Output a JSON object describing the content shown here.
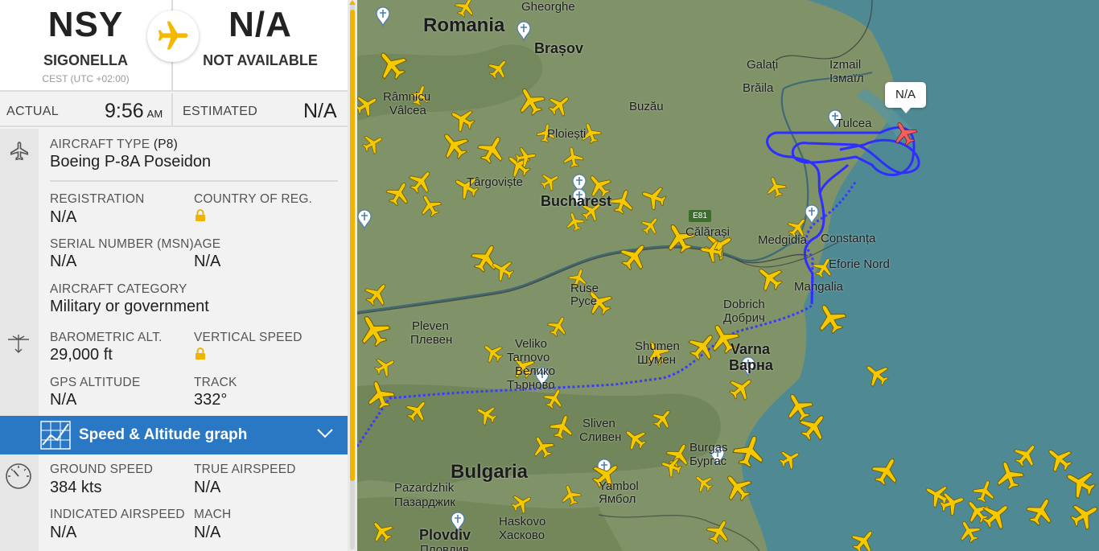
{
  "route": {
    "origin_code": "NSY",
    "origin_name": "SIGONELLA",
    "origin_tz": "CEST (UTC +02:00)",
    "dest_code": "N/A",
    "dest_name": "NOT AVAILABLE"
  },
  "times": {
    "actual_label": "ACTUAL",
    "actual_value": "9:56",
    "actual_ampm": "AM",
    "estimated_label": "ESTIMATED",
    "estimated_value": "N/A"
  },
  "aircraft": {
    "type_label": "AIRCRAFT TYPE",
    "type_code": "(P8)",
    "type_value": "Boeing P-8A Poseidon",
    "registration_label": "REGISTRATION",
    "registration_value": "N/A",
    "country_label": "COUNTRY OF REG.",
    "serial_label": "SERIAL NUMBER (MSN)",
    "serial_value": "N/A",
    "age_label": "AGE",
    "age_value": "N/A",
    "category_label": "AIRCRAFT CATEGORY",
    "category_value": "Military or government"
  },
  "altitude": {
    "baro_label": "BAROMETRIC ALT.",
    "baro_value": "29,000 ft",
    "vs_label": "VERTICAL SPEED",
    "gps_label": "GPS ALTITUDE",
    "gps_value": "N/A",
    "track_label": "TRACK",
    "track_value": "332°"
  },
  "graph_bar": {
    "title": "Speed & Altitude graph"
  },
  "speed": {
    "ground_label": "GROUND SPEED",
    "ground_value": "384 kts",
    "tas_label": "TRUE AIRSPEED",
    "tas_value": "N/A",
    "ias_label": "INDICATED AIRSPEED",
    "ias_value": "N/A",
    "mach_label": "MACH",
    "mach_value": "N/A"
  },
  "map": {
    "callout": "N/A",
    "road": "E81",
    "labels": {
      "romania": "Romania",
      "bulgaria": "Bulgaria",
      "gheorghe": "Gheorghe",
      "brasov": "Brașov",
      "galati": "Galați",
      "izmail": "Izmail",
      "izmail_cyr": "Ізмаїл",
      "braila": "Brăila",
      "ramnicu": "Râmnicu",
      "valcea": "Vâlcea",
      "buzau": "Buzău",
      "ploiesti": "Ploiești",
      "targoviste": "Târgoviște",
      "tulcea": "Tulcea",
      "bucharest": "Bucharest",
      "calarasi": "Călărași",
      "medgidia": "Medgidia",
      "constanta": "Constanța",
      "eforie": "Eforie Nord",
      "mangalia": "Mangalia",
      "ruse": "Ruse",
      "ruse_cyr": "Русе",
      "dobrich": "Dobrich",
      "dobrich_cyr": "Добрич",
      "pleven": "Pleven",
      "pleven_cyr": "Плевен",
      "veliko": "Veliko",
      "tarnovo": "Tarnovo",
      "veliko_cyr": "Велико",
      "tarnovo_cyr": "Търново",
      "shumen": "Shumen",
      "shumen_cyr": "Шумен",
      "varna": "Varna",
      "varna_cyr": "Варна",
      "sliven": "Sliven",
      "sliven_cyr": "Сливен",
      "burgas": "Burgas",
      "burgas_cyr": "Бургас",
      "pazardzhik": "Pazardzhik",
      "pazardzhik_cyr": "Пазарджик",
      "yambol": "Yambol",
      "yambol_cyr": "Ямбол",
      "haskovo": "Haskovo",
      "haskovo_cyr": "Хасково",
      "plovdiv": "Plovdiv",
      "plovdiv_cyr": "Пловдив"
    }
  }
}
